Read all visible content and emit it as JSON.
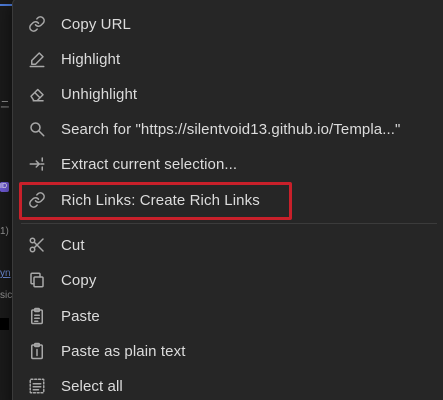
{
  "background": {
    "fragment_dash": "ニ",
    "fragment_paren": "1)",
    "fragment_link": "yn",
    "fragment_text": "sic",
    "badge_text": "ID"
  },
  "menu": {
    "items": [
      {
        "label": "Copy URL",
        "icon": "link-icon"
      },
      {
        "label": "Highlight",
        "icon": "highlighter-icon"
      },
      {
        "label": "Unhighlight",
        "icon": "eraser-icon"
      },
      {
        "label": "Search for \"https://silentvoid13.github.io/Templa...\"",
        "icon": "search-icon"
      },
      {
        "label": "Extract current selection...",
        "icon": "extract-icon"
      },
      {
        "label": "Rich Links: Create Rich Links",
        "icon": "link-icon"
      },
      {
        "label": "Cut",
        "icon": "scissors-icon"
      },
      {
        "label": "Copy",
        "icon": "copy-icon"
      },
      {
        "label": "Paste",
        "icon": "clipboard-icon"
      },
      {
        "label": "Paste as plain text",
        "icon": "clipboard-text-icon"
      },
      {
        "label": "Select all",
        "icon": "select-all-icon"
      }
    ]
  },
  "annotation": {
    "highlighted_item": "Rich Links: Create Rich Links",
    "color": "#c8202a"
  },
  "colors": {
    "menu_background": "#262626",
    "text": "#dcdcdc",
    "icon": "#a8a8a8"
  }
}
